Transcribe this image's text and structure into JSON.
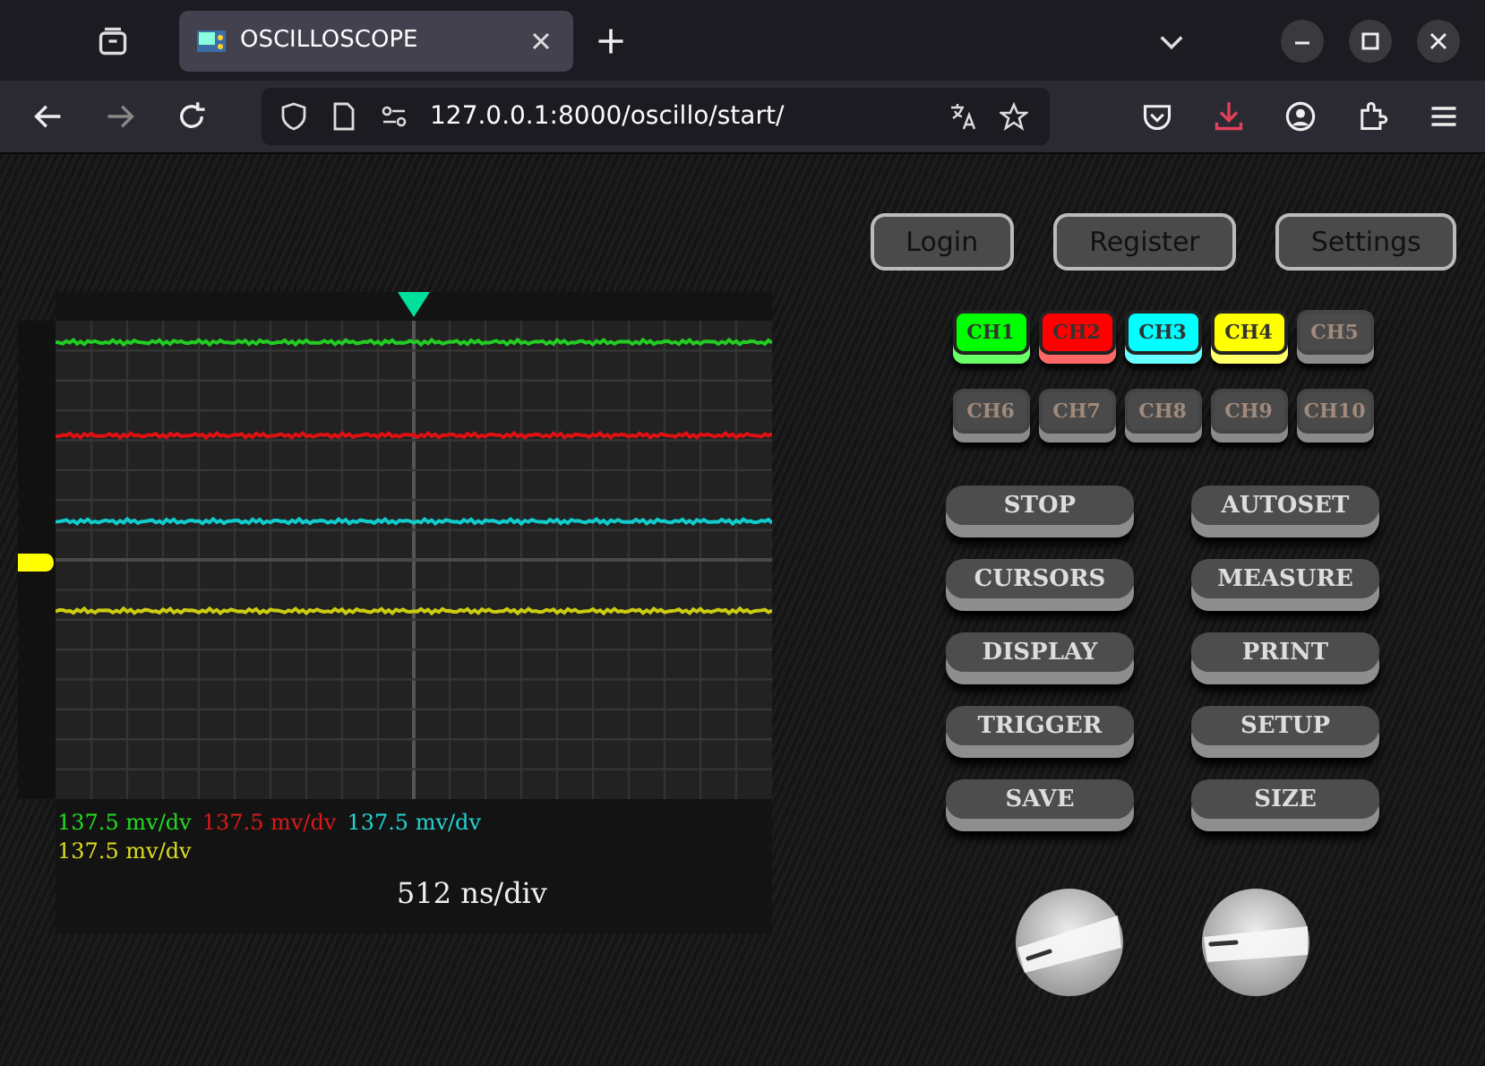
{
  "browser": {
    "tab_title": "OSCILLOSCOPE",
    "url": "127.0.0.1:8000/oscillo/start/"
  },
  "account_buttons": [
    "Login",
    "Register",
    "Settings"
  ],
  "channels": [
    {
      "label": "CH1",
      "on": true,
      "color": "#00ff00"
    },
    {
      "label": "CH2",
      "on": true,
      "color": "#ff0000"
    },
    {
      "label": "CH3",
      "on": true,
      "color": "#00ffff"
    },
    {
      "label": "CH4",
      "on": true,
      "color": "#ffff00"
    },
    {
      "label": "CH5",
      "on": false
    },
    {
      "label": "CH6",
      "on": false
    },
    {
      "label": "CH7",
      "on": false
    },
    {
      "label": "CH8",
      "on": false
    },
    {
      "label": "CH9",
      "on": false
    },
    {
      "label": "CH10",
      "on": false
    }
  ],
  "function_buttons": [
    "STOP",
    "AUTOSET",
    "CURSORS",
    "MEASURE",
    "DISPLAY",
    "PRINT",
    "TRIGGER",
    "SETUP",
    "SAVE",
    "SIZE"
  ],
  "scope": {
    "scales": [
      {
        "text": "137.5 mv/dv",
        "color": "#22dd22"
      },
      {
        "text": "137.5 mv/dv",
        "color": "#dd1a1a"
      },
      {
        "text": "137.5 mv/dv",
        "color": "#22d4d4"
      },
      {
        "text": "137.5 mv/dv",
        "color": "#dddd22"
      }
    ],
    "timebase": "512 ns/div"
  }
}
